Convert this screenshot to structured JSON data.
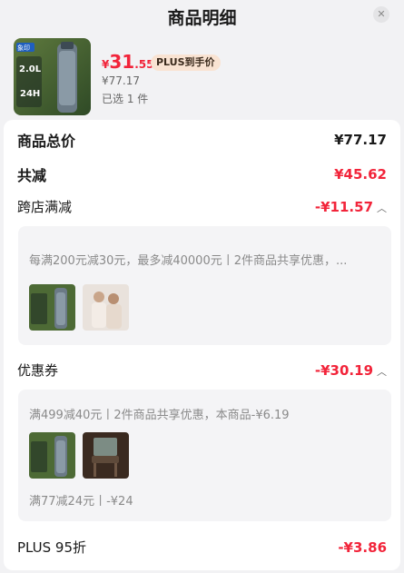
{
  "header": {
    "title": "商品明细",
    "close_icon": "close-icon"
  },
  "product": {
    "price_symbol": "¥",
    "price_int": "31",
    "price_dec": ".55",
    "plus_tag": "PLUS到手价",
    "original_price": "¥77.17",
    "selected_count": "已选 1 件",
    "thumb_badge": "象印",
    "thumb_capacity": "2.0L",
    "thumb_hours": "24H"
  },
  "summary": {
    "total_label": "商品总价",
    "total_value": "¥77.17",
    "reduce_label": "共减",
    "reduce_value": "¥45.62"
  },
  "cross_store": {
    "label": "跨店满减",
    "value": "-¥11.57",
    "detail": "每满200元减30元，最多减40000元丨2件商品共享优惠，..."
  },
  "coupon": {
    "label": "优惠券",
    "value": "-¥30.19",
    "detail1": "满499减40元丨2件商品共享优惠，本商品-¥6.19",
    "detail2": "满77减24元丨-¥24"
  },
  "plus": {
    "label": "PLUS 95折",
    "value": "-¥3.86"
  },
  "colors": {
    "accent_red": "#f2243a",
    "plus_tag_bg": "#f9e3d2"
  }
}
